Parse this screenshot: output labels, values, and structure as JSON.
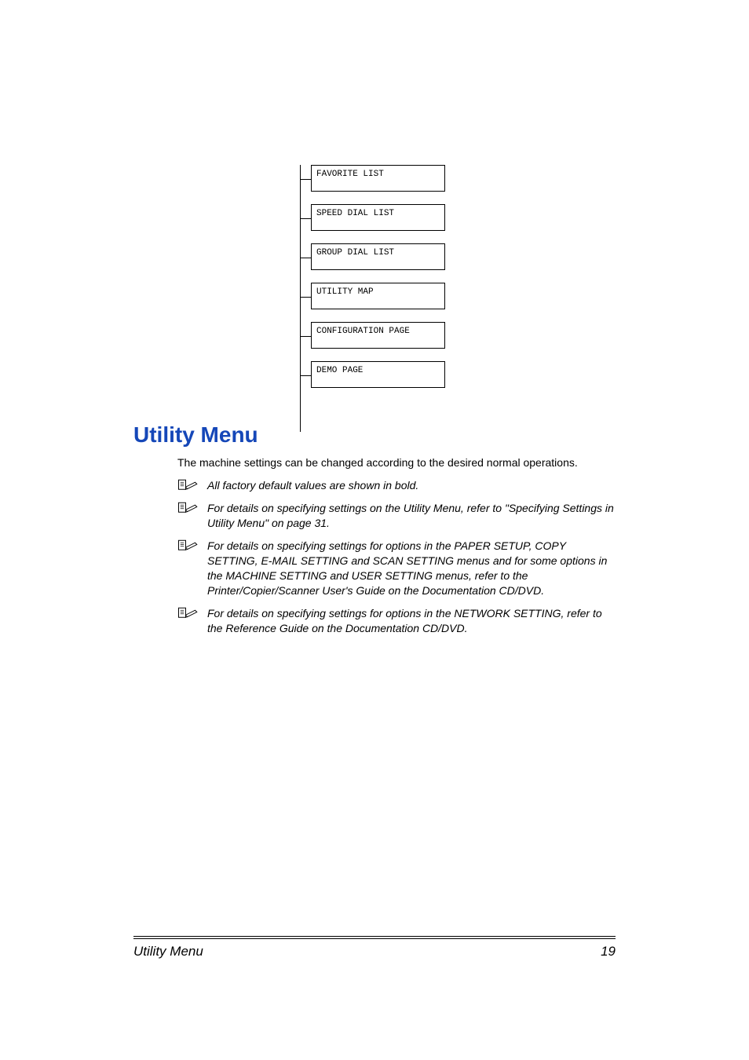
{
  "diagram": {
    "nodes": [
      "FAVORITE LIST",
      "SPEED DIAL LIST",
      "GROUP DIAL LIST",
      "UTILITY MAP",
      "CONFIGURATION PAGE",
      "DEMO PAGE"
    ]
  },
  "heading": "Utility Menu",
  "intro": "The machine settings can be changed according to the desired normal operations.",
  "notes": [
    "All factory default values are shown in bold.",
    "For details on specifying settings on the Utility Menu, refer to \"Specifying Settings in Utility Menu\" on page 31.",
    "For details on specifying settings for options in the PAPER SETUP, COPY SETTING, E-MAIL SETTING and SCAN SETTING menus and for some options in the MACHINE SETTING and USER SETTING menus, refer to the Printer/Copier/Scanner User's Guide on the Documentation CD/DVD.",
    "For details on specifying settings for options in the NETWORK SETTING, refer to the Reference Guide on the Documentation CD/DVD."
  ],
  "footer": {
    "left": "Utility Menu",
    "right": "19"
  }
}
